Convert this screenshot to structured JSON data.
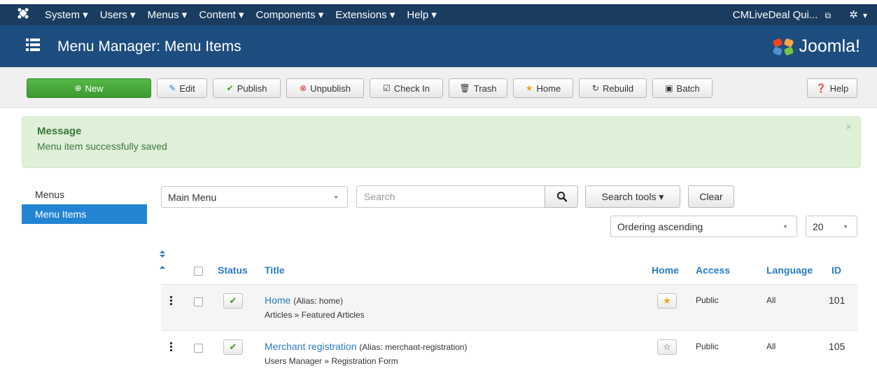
{
  "topnav": {
    "logo_icon": "joomla-icon",
    "menus": [
      "System ▾",
      "Users ▾",
      "Menus ▾",
      "Content ▾",
      "Components ▾",
      "Extensions ▾",
      "Help ▾"
    ],
    "site_label": "CMLiveDeal Qui...",
    "site_icon": "external-link-icon",
    "settings_icon": "gear-icon",
    "settings_caret": "▾"
  },
  "header": {
    "icon": "list-icon",
    "title": "Menu Manager: Menu Items",
    "brand": "Joomla!",
    "brand_icon": "joomla-logo-icon"
  },
  "toolbar": {
    "new": "New",
    "edit": "Edit",
    "publish": "Publish",
    "unpublish": "Unpublish",
    "checkin": "Check In",
    "trash": "Trash",
    "home": "Home",
    "rebuild": "Rebuild",
    "batch": "Batch",
    "help": "Help"
  },
  "message": {
    "heading": "Message",
    "body": "Menu item successfully saved",
    "close": "×"
  },
  "sidebar": {
    "items": [
      {
        "label": "Menus",
        "active": false
      },
      {
        "label": "Menu Items",
        "active": true
      }
    ]
  },
  "filters": {
    "menu_select": "Main Menu",
    "search_placeholder": "Search",
    "search_tools": "Search tools ▾",
    "clear": "Clear",
    "ordering": "Ordering ascending",
    "limit": "20"
  },
  "table": {
    "headers": {
      "status": "Status",
      "title": "Title",
      "home": "Home",
      "access": "Access",
      "language": "Language",
      "id": "ID"
    },
    "rows": [
      {
        "title": "Home",
        "alias": "(Alias: home)",
        "type": "Articles » Featured Articles",
        "home": true,
        "access": "Public",
        "language": "All",
        "id": "101"
      },
      {
        "title": "Merchant registration",
        "alias": "(Alias: merchant-registration)",
        "type": "Users Manager » Registration Form",
        "home": false,
        "access": "Public",
        "language": "All",
        "id": "105"
      }
    ]
  },
  "colors": {
    "topnav_bg": "#1b3c61",
    "header_bg": "#1d4c7e",
    "new_button": "#46a83a",
    "link": "#2b7ac2",
    "sidebar_active": "#2384d3",
    "message_bg": "#dff0d8",
    "message_text": "#3c763d"
  }
}
